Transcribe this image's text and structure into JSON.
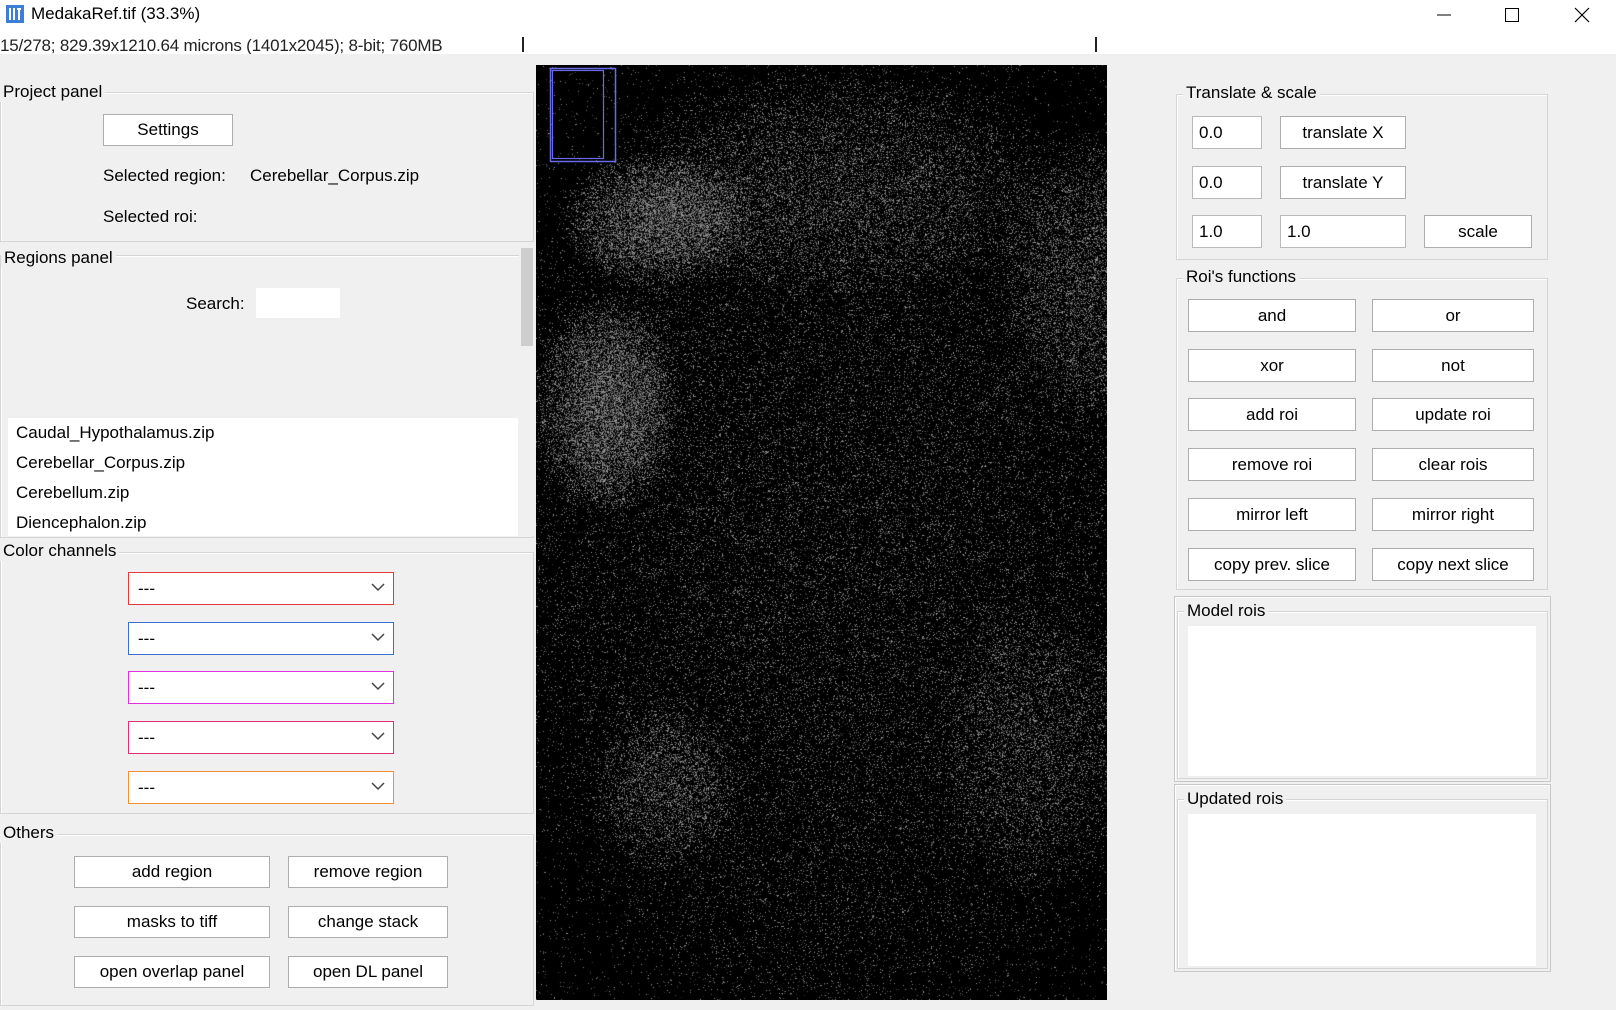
{
  "window": {
    "title": "MedakaRef.tif (33.3%)",
    "icon": "imagej-icon",
    "controls": [
      "minimize-icon",
      "maximize-icon",
      "close-icon"
    ]
  },
  "info_bar": {
    "text": "15/278; 829.39x1210.64 microns (1401x2045); 8-bit; 760MB"
  },
  "project_panel": {
    "title": "Project panel",
    "settings_label": "Settings",
    "selected_region_label": "Selected region:",
    "selected_region_value": "Cerebellar_Corpus.zip",
    "selected_roi_label": "Selected roi:"
  },
  "regions_panel": {
    "title": "Regions panel",
    "search_label": "Search:",
    "search_value": "",
    "items": [
      "Caudal_Hypothalamus.zip",
      "Cerebellar_Corpus.zip",
      "Cerebellum.zip",
      "Diencephalon.zip"
    ]
  },
  "color_channels": {
    "title": "Color channels",
    "channels": [
      {
        "value": "---",
        "color": "#e03a3a"
      },
      {
        "value": "---",
        "color": "#3a6fd0"
      },
      {
        "value": "---",
        "color": "#e030e0"
      },
      {
        "value": "---",
        "color": "#e0307a"
      },
      {
        "value": "---",
        "color": "#f09030"
      }
    ]
  },
  "others": {
    "title": "Others",
    "add_region": "add region",
    "remove_region": "remove region",
    "masks_to_tiff": "masks to tiff",
    "change_stack": "change stack",
    "open_overlap_panel": "open overlap panel",
    "open_dl_panel": "open DL panel"
  },
  "translate_scale": {
    "title": "Translate & scale",
    "x_value": "0.0",
    "translate_x": "translate X",
    "y_value": "0.0",
    "translate_y": "translate Y",
    "scale_x_value": "1.0",
    "scale_y_value": "1.0",
    "scale": "scale"
  },
  "roi_functions": {
    "title": "Roi's functions",
    "and": "and",
    "or": "or",
    "xor": "xor",
    "not": "not",
    "add_roi": "add roi",
    "update_roi": "update roi",
    "remove_roi": "remove roi",
    "clear_rois": "clear rois",
    "mirror_left": "mirror left",
    "mirror_right": "mirror right",
    "copy_prev_slice": "copy prev. slice",
    "copy_next_slice": "copy next slice"
  },
  "model_rois": {
    "title": "Model rois"
  },
  "updated_rois": {
    "title": "Updated rois"
  },
  "viewer": {
    "background": "#000000",
    "navigator_color": "#6a6ae8"
  }
}
